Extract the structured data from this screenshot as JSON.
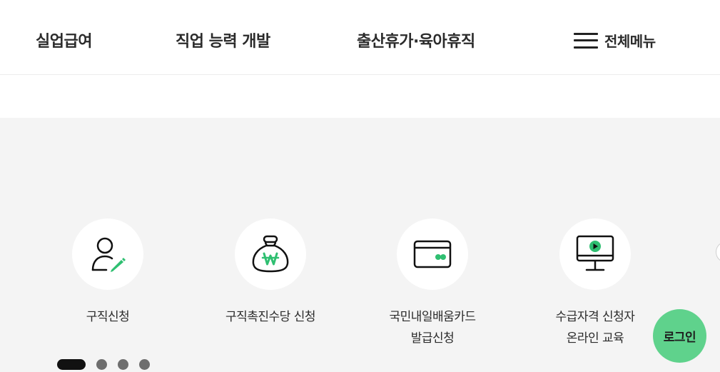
{
  "nav": {
    "items": [
      {
        "label": "실업급여"
      },
      {
        "label": "직업 능력 개발"
      },
      {
        "label": "출산휴가·육아휴직"
      }
    ],
    "all_menu": {
      "label": "전체메뉴",
      "icon": "hamburger-menu-icon"
    }
  },
  "quick_links": [
    {
      "label": "구직신청",
      "icon": "person-edit-icon"
    },
    {
      "label": "구직촉진수당 신청",
      "icon": "money-bag-won-icon"
    },
    {
      "label_line1": "국민내일배움카드",
      "label_line2": "발급신청",
      "icon": "credit-card-icon"
    },
    {
      "label_line1": "수급자격 신청자",
      "label_line2": "온라인 교육",
      "icon": "monitor-play-icon"
    }
  ],
  "pager": {
    "total": 4,
    "active_index": 0
  },
  "login": {
    "label": "로그인"
  },
  "colors": {
    "accent": "#2fbf71",
    "login_bg": "#5fd28c",
    "section_bg": "#f4f4f4"
  }
}
